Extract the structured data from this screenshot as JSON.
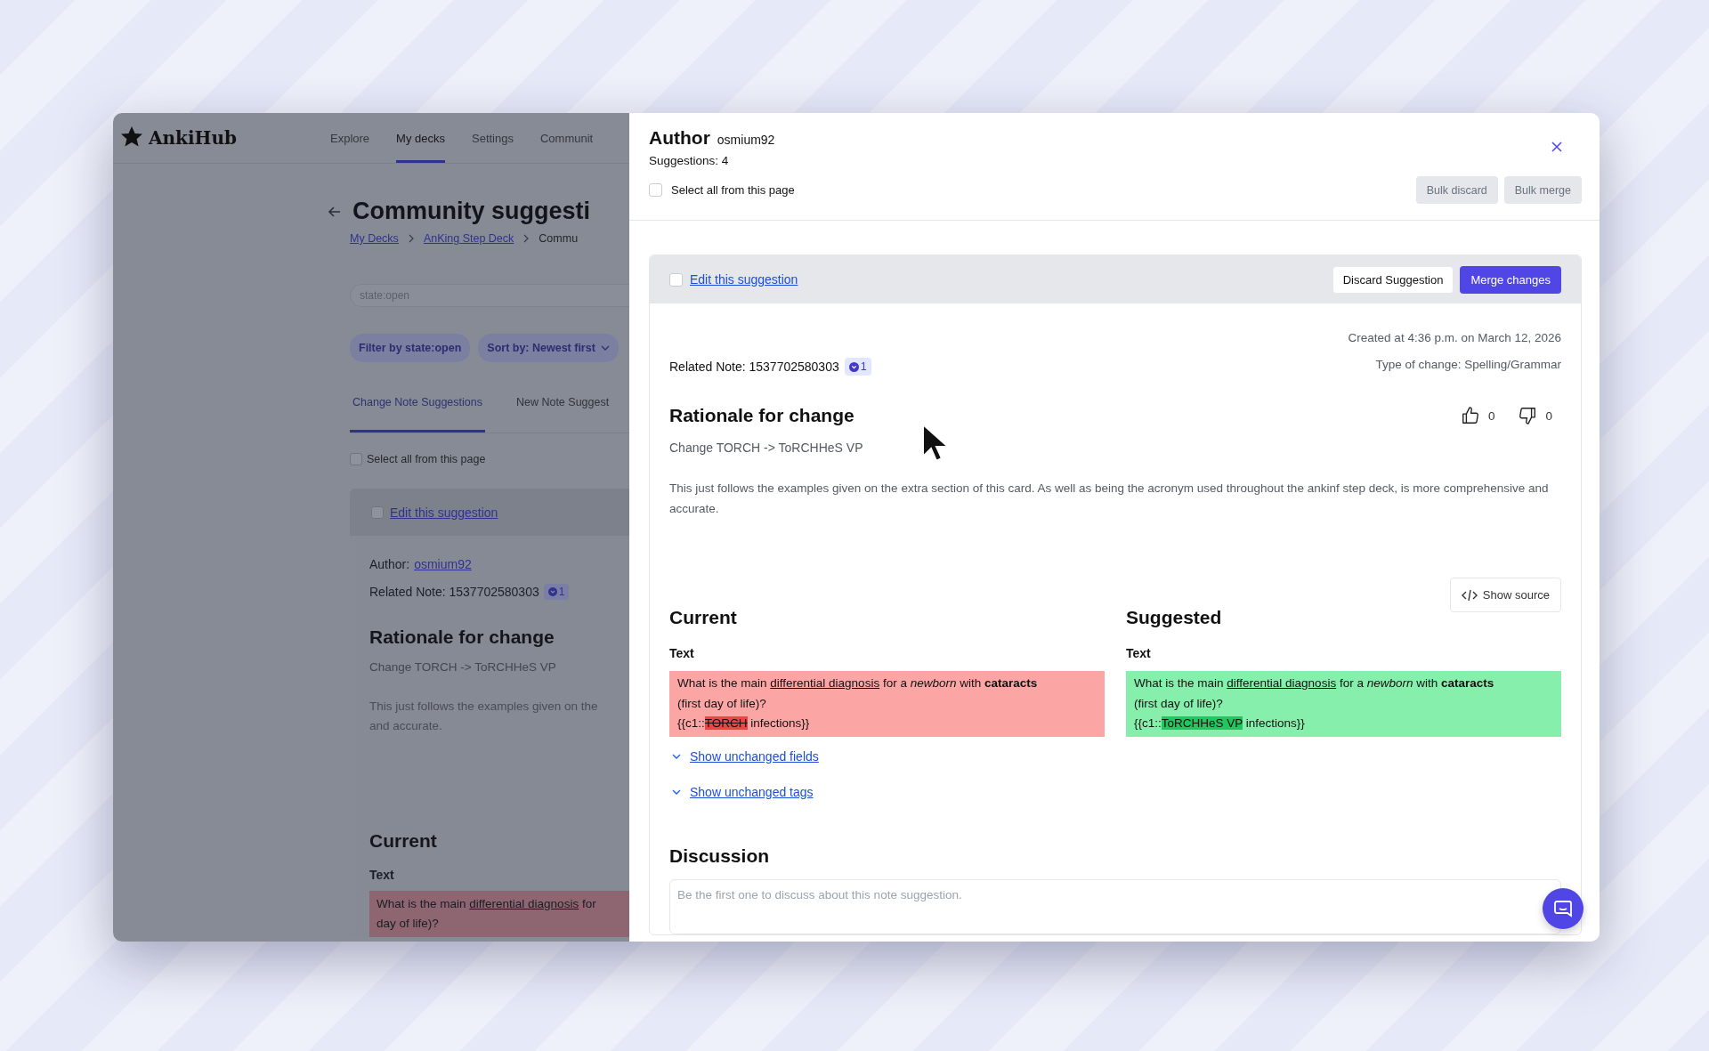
{
  "app": {
    "logo": "AnkiHub",
    "nav": [
      {
        "label": "Explore",
        "selected": false
      },
      {
        "label": "My decks",
        "selected": true
      },
      {
        "label": "Settings",
        "selected": false
      },
      {
        "label": "Communit",
        "selected": false
      }
    ],
    "page_title": "Community suggesti",
    "breadcrumbs": [
      "My Decks",
      "AnKing Step Deck",
      "Commu"
    ],
    "search": {
      "value": "state:open"
    },
    "filters": [
      {
        "label": "Filter by state:open",
        "dropdown": false
      },
      {
        "label": "Sort by: Newest first",
        "dropdown": true
      }
    ],
    "tabs": [
      {
        "label": "Change Note Suggestions",
        "selected": true
      },
      {
        "label": "New Note Suggest",
        "selected": false
      }
    ],
    "select_all": {
      "label": "Select all from this page",
      "checked": false
    },
    "card": {
      "checked": false,
      "edit_link": "Edit this suggestion",
      "author_label": "Author:",
      "author": "osmium92",
      "related_note": "Related Note: 1537702580303",
      "badge": "1",
      "rationale_title": "Rationale for change",
      "summary": "Change TORCH -> ToRCHHeS VP",
      "body": [
        "This just follows the examples given on the",
        "and accurate."
      ],
      "current_title": "Current",
      "field_label": "Text",
      "current_lines": [
        [
          {
            "kind": "plain",
            "text": "What is the main "
          },
          {
            "kind": "underline",
            "text": "differential diagnosis"
          },
          {
            "kind": "plain",
            "text": " for"
          }
        ],
        [
          {
            "kind": "plain",
            "text": "day of life)?"
          }
        ]
      ]
    }
  },
  "drawer": {
    "title": "Author",
    "author": "osmium92",
    "count": "Suggestions: 4",
    "select_all": {
      "label": "Select all from this page",
      "checked": false
    },
    "bulk_buttons": [
      "Bulk discard",
      "Bulk merge"
    ],
    "suggestion": {
      "checked": false,
      "edit_link": "Edit this suggestion",
      "discard": "Discard Suggestion",
      "merge": "Merge changes",
      "created": "Created at 4:36 p.m. on March 12, 2026",
      "related_note": "Related Note: 1537702580303",
      "badge": "1",
      "change_type": "Type of change: Spelling/Grammar",
      "rationale_title": "Rationale for change",
      "upvotes": "0",
      "downvotes": "0",
      "summary": "Change TORCH -> ToRCHHeS VP",
      "body": "This just follows the examples given on the extra section of this card. As well as being the acronym used throughout the ankinf step deck, is more comprehensive and accurate.",
      "show_source": "Show source",
      "columns": [
        {
          "title": "Current",
          "field_label": "Text",
          "kind": "removed",
          "lines": [
            [
              {
                "kind": "plain",
                "text": "What is the main "
              },
              {
                "kind": "underline",
                "text": "differential diagnosis"
              },
              {
                "kind": "plain",
                "text": " for a "
              },
              {
                "kind": "italic",
                "text": "newborn"
              },
              {
                "kind": "plain",
                "text": " with "
              },
              {
                "kind": "bold",
                "text": "cataracts"
              }
            ],
            [
              {
                "kind": "plain",
                "text": "(first day of life)?"
              }
            ],
            [
              {
                "kind": "plain",
                "text": "{{c1::"
              },
              {
                "kind": "removed",
                "text": "TORCH"
              },
              {
                "kind": "plain",
                "text": " infections}}"
              }
            ]
          ]
        },
        {
          "title": "Suggested",
          "field_label": "Text",
          "kind": "added",
          "lines": [
            [
              {
                "kind": "plain",
                "text": "What is the main "
              },
              {
                "kind": "underline",
                "text": "differential diagnosis"
              },
              {
                "kind": "plain",
                "text": " for a "
              },
              {
                "kind": "italic",
                "text": "newborn"
              },
              {
                "kind": "plain",
                "text": " with "
              },
              {
                "kind": "bold",
                "text": "cataracts"
              }
            ],
            [
              {
                "kind": "plain",
                "text": "(first day of life)?"
              }
            ],
            [
              {
                "kind": "plain",
                "text": "{{c1::"
              },
              {
                "kind": "added",
                "text": "ToRCHHeS VP"
              },
              {
                "kind": "plain",
                "text": " infections}}"
              }
            ]
          ]
        }
      ],
      "toggles": [
        "Show unchanged fields",
        "Show unchanged tags"
      ],
      "discussion_title": "Discussion",
      "discussion": {
        "placeholder": "Be the first one to discuss about this note suggestion."
      }
    }
  }
}
